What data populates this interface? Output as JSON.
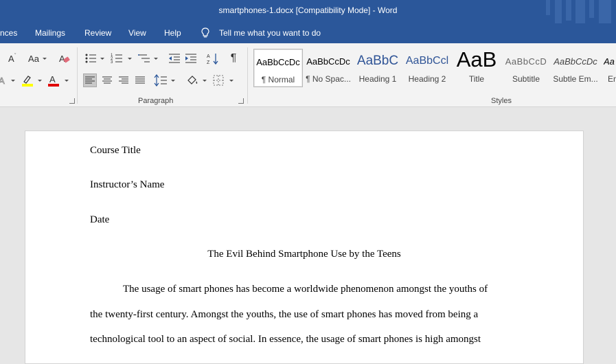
{
  "window": {
    "title": "smartphones-1.docx [Compatibility Mode]  -  Word"
  },
  "tabs": [
    "nces",
    "Mailings",
    "Review",
    "View",
    "Help"
  ],
  "tell_me": {
    "label": "Tell me what you want to do",
    "icon": "lightbulb-icon"
  },
  "ribbon": {
    "font_group": {
      "change_case_label": "Aa",
      "icons": [
        "grow-font-icon",
        "change-case-icon",
        "clear-formatting-icon",
        "text-effects-icon",
        "highlight-icon",
        "font-color-icon"
      ]
    },
    "paragraph_group": {
      "label": "Paragraph",
      "icons": [
        "bullets-icon",
        "numbering-icon",
        "multilevel-list-icon",
        "decrease-indent-icon",
        "increase-indent-icon",
        "sort-icon",
        "show-formatting-icon",
        "align-left-icon",
        "center-icon",
        "align-right-icon",
        "justify-icon",
        "line-spacing-icon",
        "shading-icon",
        "borders-icon"
      ]
    },
    "styles_group": {
      "label": "Styles",
      "styles": [
        {
          "sample": "AaBbCcDc",
          "name": "¶ Normal"
        },
        {
          "sample": "AaBbCcDc",
          "name": "¶ No Spac..."
        },
        {
          "sample": "AaBbC",
          "name": "Heading 1"
        },
        {
          "sample": "AaBbCcl",
          "name": "Heading 2"
        },
        {
          "sample": "AaB",
          "name": "Title"
        },
        {
          "sample": "AaBbCcD",
          "name": "Subtitle"
        },
        {
          "sample": "AaBbCcDc",
          "name": "Subtle Em..."
        },
        {
          "sample": "Aa",
          "name": "En"
        }
      ]
    }
  },
  "document": {
    "lines": [
      "Course Title",
      "Instructor’s Name",
      "Date"
    ],
    "heading": "The Evil Behind Smartphone Use by the Teens",
    "body": [
      "The usage of smart phones has become a worldwide phenomenon amongst the youths of",
      "the twenty-first century. Amongst the youths, the use of smart phones has moved from being a",
      "technological tool to an aspect of social. In essence, the usage of smart phones is high amongst"
    ]
  },
  "colors": {
    "titlebar": "#2b579a",
    "ribbon": "#f3f3f3",
    "canvas": "#e6e6e6",
    "highlight": "#ffff00",
    "font_color": "#e00000",
    "heading_blue": "#2f5496"
  }
}
